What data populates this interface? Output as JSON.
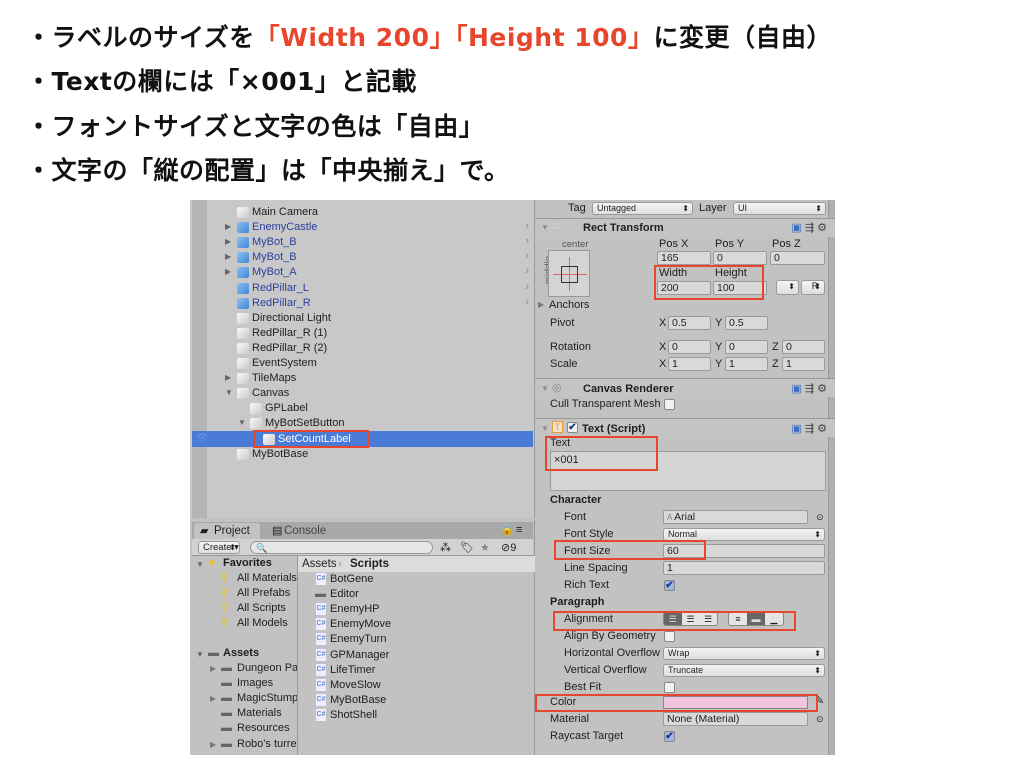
{
  "slide": {
    "lines": [
      {
        "bullet": "・",
        "parts": [
          {
            "text": "ラベルのサイズを",
            "red": false
          },
          {
            "text": "「Width 200」「Height 100」",
            "red": true
          },
          {
            "text": "に変更（自由）",
            "red": false
          }
        ]
      },
      {
        "bullet": "・",
        "parts": [
          {
            "text": "Textの欄には「×001」と記載",
            "red": false
          }
        ]
      },
      {
        "bullet": "・",
        "parts": [
          {
            "text": "フォントサイズと文字の色は「自由」",
            "red": false
          }
        ]
      },
      {
        "bullet": "・",
        "parts": [
          {
            "text": "文字の「縦の配置」は「中央揃え」で。",
            "red": false
          }
        ]
      }
    ],
    "accent_color": "#e8462c"
  },
  "hierarchy": {
    "items": [
      {
        "label": "Main Camera",
        "depth": 0,
        "arrow": "",
        "prefab": false
      },
      {
        "label": "EnemyCastle",
        "depth": 0,
        "arrow": "right",
        "prefab": true
      },
      {
        "label": "MyBot_B",
        "depth": 0,
        "arrow": "right",
        "prefab": true
      },
      {
        "label": "MyBot_B",
        "depth": 0,
        "arrow": "right",
        "prefab": true
      },
      {
        "label": "MyBot_A",
        "depth": 0,
        "arrow": "right",
        "prefab": true
      },
      {
        "label": "RedPillar_L",
        "depth": 0,
        "arrow": "",
        "prefab": true
      },
      {
        "label": "RedPillar_R",
        "depth": 0,
        "arrow": "",
        "prefab": true
      },
      {
        "label": "Directional Light",
        "depth": 0,
        "arrow": "",
        "prefab": false
      },
      {
        "label": "RedPillar_R (1)",
        "depth": 0,
        "arrow": "",
        "prefab": false
      },
      {
        "label": "RedPillar_R (2)",
        "depth": 0,
        "arrow": "",
        "prefab": false
      },
      {
        "label": "EventSystem",
        "depth": 0,
        "arrow": "",
        "prefab": false
      },
      {
        "label": "TileMaps",
        "depth": 0,
        "arrow": "right",
        "prefab": false
      },
      {
        "label": "Canvas",
        "depth": 0,
        "arrow": "down",
        "prefab": false
      },
      {
        "label": "GPLabel",
        "depth": 1,
        "arrow": "",
        "prefab": false
      },
      {
        "label": "MyBotSetButton",
        "depth": 1,
        "arrow": "down",
        "prefab": false
      },
      {
        "label": "SetCountLabel",
        "depth": 2,
        "arrow": "",
        "prefab": false,
        "selected": true
      },
      {
        "label": "MyBotBase",
        "depth": 0,
        "arrow": "",
        "prefab": false
      }
    ],
    "selected_color": "#4a7bd6",
    "prefab_color": "#2b3fa0"
  },
  "project": {
    "tabs": [
      "Project",
      "Console"
    ],
    "create_label": "Create ▾",
    "search_placeholder": "",
    "hidden_count": "9",
    "favorites_label": "Favorites",
    "favorites": [
      "All Materials",
      "All Prefabs",
      "All Scripts",
      "All Models"
    ],
    "assets_label": "Assets",
    "assets": [
      {
        "label": "Dungeon Pa",
        "arrow": true
      },
      {
        "label": "Images",
        "arrow": false
      },
      {
        "label": "MagicStump",
        "arrow": true
      },
      {
        "label": "Materials",
        "arrow": false
      },
      {
        "label": "Resources",
        "arrow": false
      },
      {
        "label": "Robo's turre",
        "arrow": true
      }
    ],
    "breadcrumb": [
      "Assets",
      "Scripts"
    ],
    "files": [
      {
        "label": "BotGene",
        "type": "script"
      },
      {
        "label": "Editor",
        "type": "folder"
      },
      {
        "label": "EnemyHP",
        "type": "script"
      },
      {
        "label": "EnemyMove",
        "type": "script"
      },
      {
        "label": "EnemyTurn",
        "type": "script"
      },
      {
        "label": "GPManager",
        "type": "script"
      },
      {
        "label": "LifeTimer",
        "type": "script"
      },
      {
        "label": "MoveSlow",
        "type": "script"
      },
      {
        "label": "MyBotBase",
        "type": "script"
      },
      {
        "label": "ShotShell",
        "type": "script"
      }
    ]
  },
  "inspector": {
    "tag_label": "Tag",
    "tag_value": "Untagged",
    "layer_label": "Layer",
    "layer_value": "UI",
    "rect": {
      "title": "Rect Transform",
      "anchor_h": "center",
      "anchor_v": "middle",
      "pos_x_label": "Pos X",
      "pos_y_label": "Pos Y",
      "pos_z_label": "Pos Z",
      "pos_x": "165",
      "pos_y": "0",
      "pos_z": "0",
      "width_label": "Width",
      "height_label": "Height",
      "width": "200",
      "height": "100",
      "r_label": "R",
      "anchors_label": "Anchors",
      "pivot_label": "Pivot",
      "pivot_x": "0.5",
      "pivot_y": "0.5",
      "rotation_label": "Rotation",
      "rot_x": "0",
      "rot_y": "0",
      "rot_z": "0",
      "scale_label": "Scale",
      "scale_x": "1",
      "scale_y": "1",
      "scale_z": "1",
      "x": "X",
      "y": "Y",
      "z": "Z"
    },
    "canvas_renderer": {
      "title": "Canvas Renderer",
      "cull_label": "Cull Transparent Mesh",
      "cull": false
    },
    "text_script": {
      "title": "Text (Script)",
      "text_label": "Text",
      "text_value": "×001",
      "character_label": "Character",
      "font_label": "Font",
      "font_value": "Arial",
      "font_style_label": "Font Style",
      "font_style_value": "Normal",
      "font_size_label": "Font Size",
      "font_size_value": "60",
      "line_spacing_label": "Line Spacing",
      "line_spacing_value": "1",
      "rich_text_label": "Rich Text",
      "rich_text": true,
      "paragraph_label": "Paragraph",
      "alignment_label": "Alignment",
      "alignment_h": "left",
      "alignment_v": "middle",
      "align_geom_label": "Align By Geometry",
      "align_geom": false,
      "h_overflow_label": "Horizontal Overflow",
      "h_overflow_value": "Wrap",
      "v_overflow_label": "Vertical Overflow",
      "v_overflow_value": "Truncate",
      "best_fit_label": "Best Fit",
      "best_fit": false,
      "color_label": "Color",
      "color_value": "#f0c4de",
      "material_label": "Material",
      "material_value": "None (Material)",
      "raycast_label": "Raycast Target",
      "raycast": true
    }
  }
}
